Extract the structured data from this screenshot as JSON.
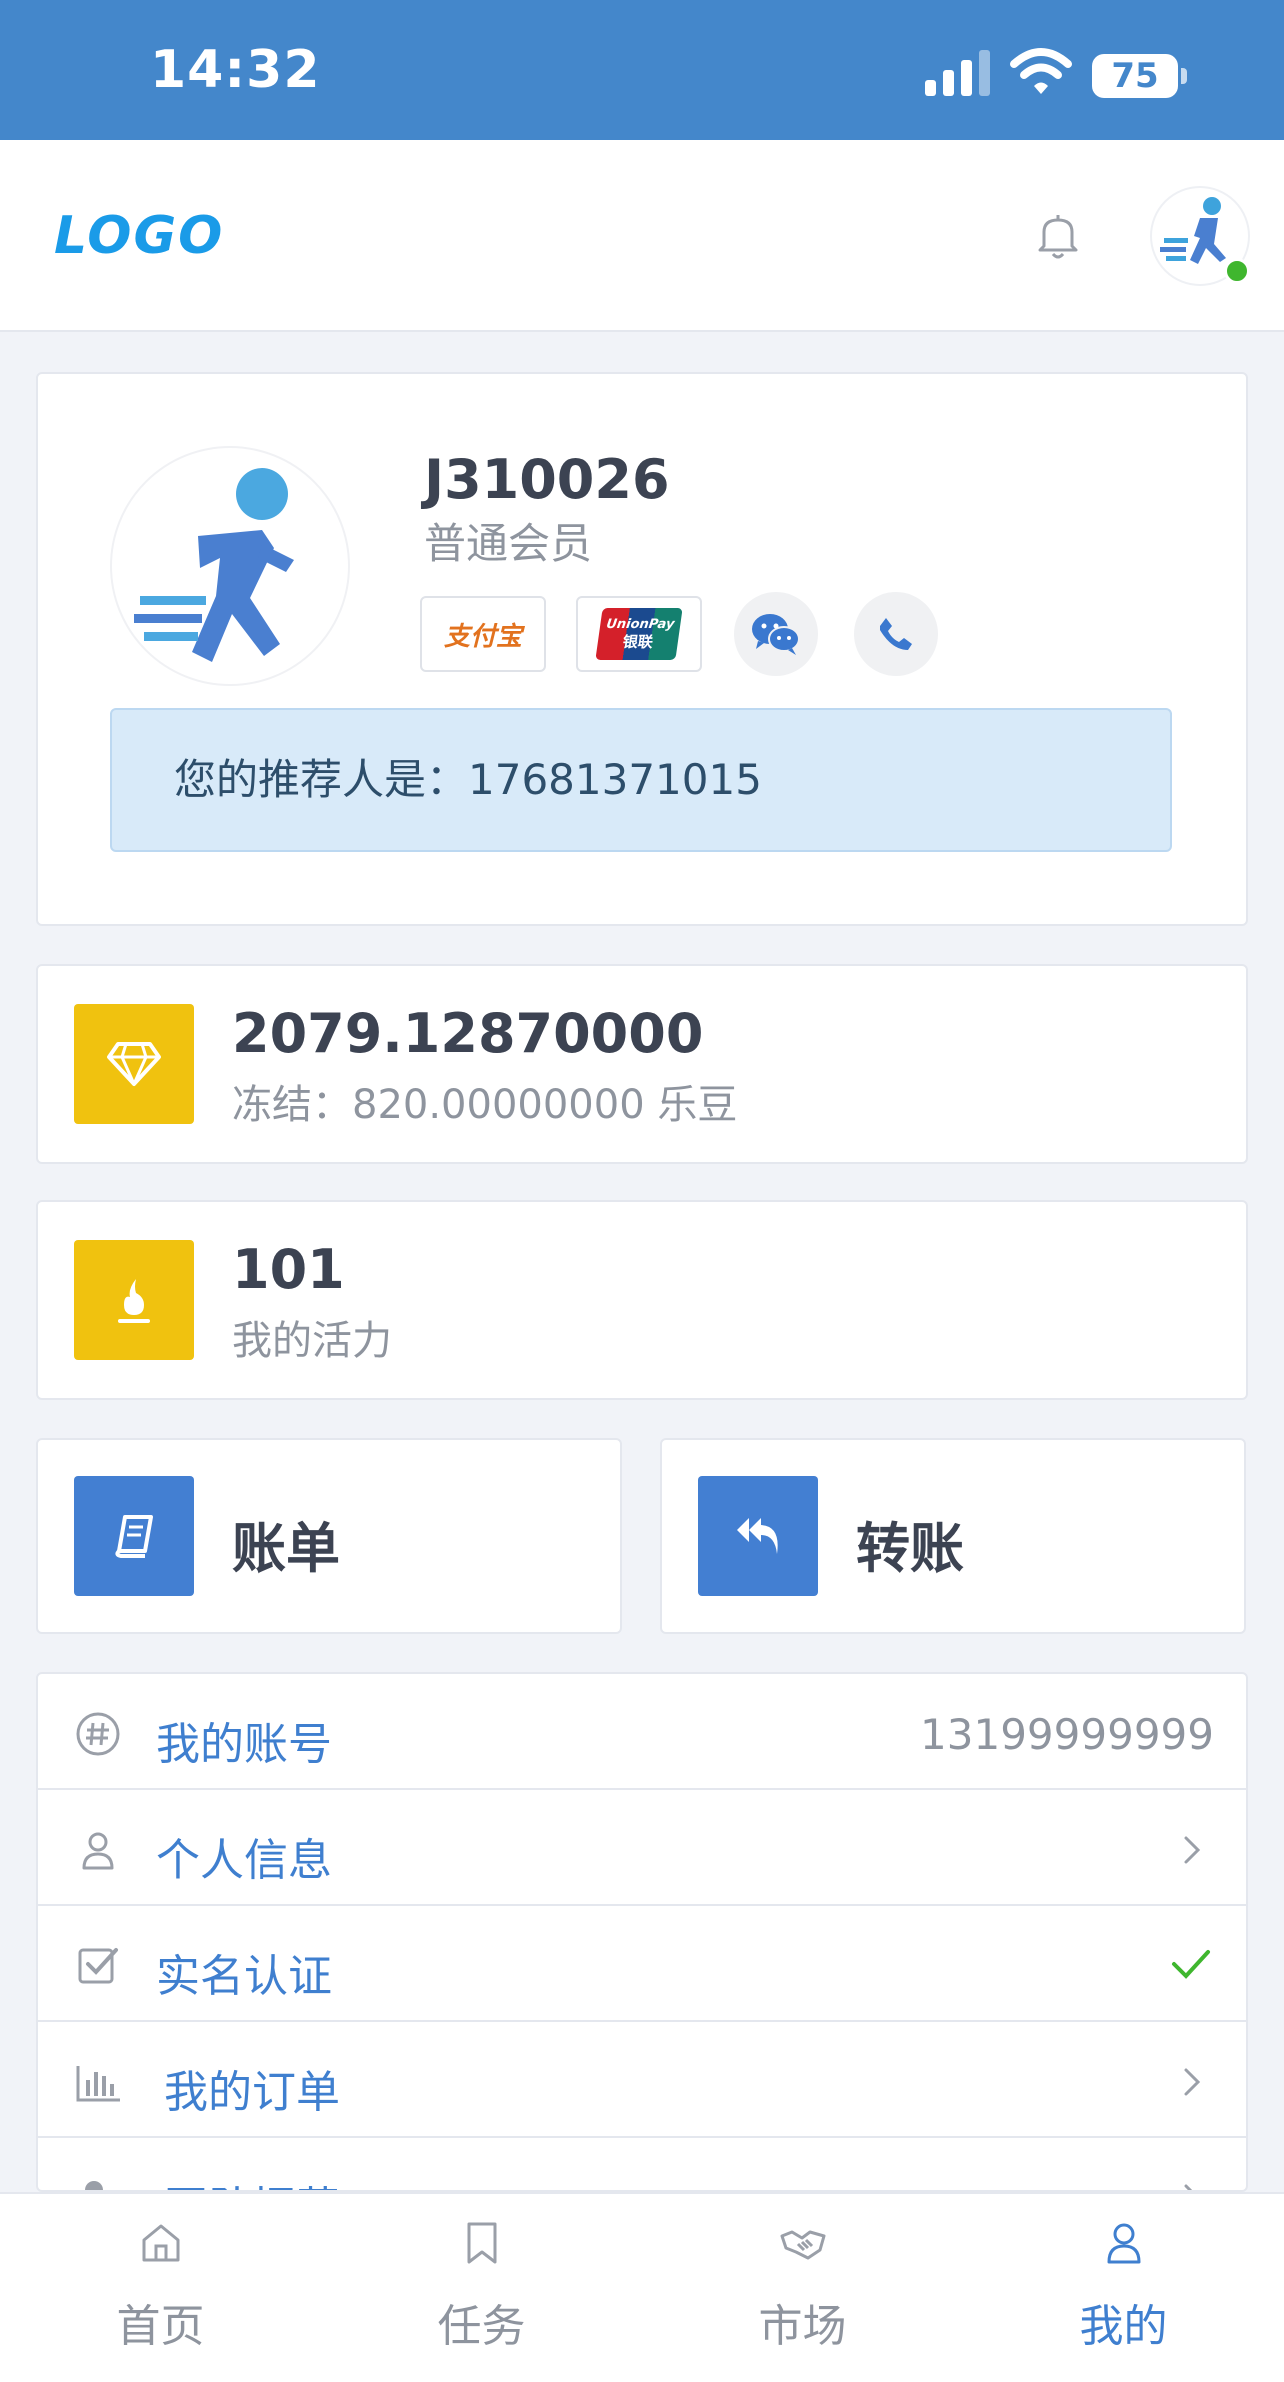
{
  "status_bar": {
    "time": "14:32",
    "battery": "75"
  },
  "header": {
    "logo": "LOGO"
  },
  "profile": {
    "username": "J310026",
    "member_level": "普通会员",
    "alipay_label": "支付宝",
    "unionpay_label": "UnionPay",
    "unionpay_sub": "银联",
    "referrer_text": "您的推荐人是：17681371015"
  },
  "balance": {
    "value": "2079.12870000",
    "frozen_text": "冻结：820.00000000 乐豆"
  },
  "vitality": {
    "value": "101",
    "label": "我的活力"
  },
  "actions": [
    {
      "label": "账单",
      "icon": "book-icon"
    },
    {
      "label": "转账",
      "icon": "reply-all-icon"
    }
  ],
  "menu": {
    "items": [
      {
        "label": "我的账号",
        "value": "13199999999",
        "icon": "hashtag-icon"
      },
      {
        "label": "个人信息",
        "icon": "user-icon"
      },
      {
        "label": "实名认证",
        "icon": "checkbox-icon"
      },
      {
        "label": "我的订单",
        "icon": "bar-chart-icon"
      },
      {
        "label": "团队招募",
        "icon": "team-icon"
      }
    ]
  },
  "bottom_nav": {
    "items": [
      {
        "label": "首页",
        "icon": "home-icon"
      },
      {
        "label": "任务",
        "icon": "bookmark-icon"
      },
      {
        "label": "市场",
        "icon": "handshake-icon"
      },
      {
        "label": "我的",
        "icon": "user-icon",
        "active": true
      }
    ]
  },
  "colors": {
    "accent": "#3f7fcf",
    "status_bar": "#4487cb",
    "gold": "#f0c20f",
    "blue_tile": "#437fd2",
    "success": "#3fb62e"
  }
}
